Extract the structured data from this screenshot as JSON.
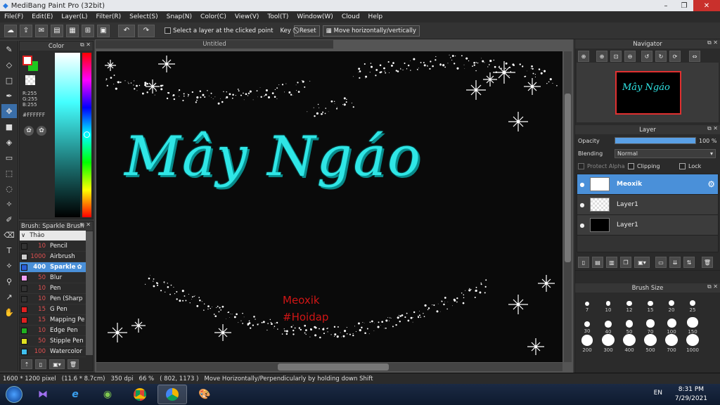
{
  "window": {
    "title": "MediBang Paint Pro (32bit)",
    "minimize": "–",
    "restore": "❐",
    "close": "✕"
  },
  "menu": [
    "File(F)",
    "Edit(E)",
    "Layer(L)",
    "Filter(R)",
    "Select(S)",
    "Snap(N)",
    "Color(C)",
    "View(V)",
    "Tool(T)",
    "Window(W)",
    "Cloud",
    "Help"
  ],
  "toolbar": {
    "select_layer_label": "Select a layer at the clicked point",
    "key_label": "Key",
    "reset_label": "Reset",
    "move_hv_label": "Move horizontally/vertically"
  },
  "color_panel": {
    "title": "Color",
    "r": "R:255",
    "g": "G:255",
    "b": "B:255",
    "hex": "#FFFFFF",
    "fg": "#ffffff",
    "bg": "#1ec81e"
  },
  "brush_panel": {
    "title": "Brush: Sparkle Brush",
    "group": "Thảo",
    "items": [
      {
        "size": "10",
        "name": "Pencil",
        "color": "#333333"
      },
      {
        "size": "1000",
        "name": "Airbrush",
        "color": "#cccccc"
      },
      {
        "size": "400",
        "name": "Sparkle",
        "color": "#2a5fd9",
        "selected": true
      },
      {
        "size": "50",
        "name": "Blur",
        "color": "#f2a0f2"
      },
      {
        "size": "10",
        "name": "Pen",
        "color": "#333333"
      },
      {
        "size": "10",
        "name": "Pen (Sharp",
        "color": "#333333"
      },
      {
        "size": "15",
        "name": "G Pen",
        "color": "#e02020"
      },
      {
        "size": "15",
        "name": "Mapping Pe",
        "color": "#e02020"
      },
      {
        "size": "10",
        "name": "Edge Pen",
        "color": "#20b020"
      },
      {
        "size": "50",
        "name": "Stipple Pen",
        "color": "#e0e020"
      },
      {
        "size": "100",
        "name": "Watercolor",
        "color": "#40c0f0"
      }
    ]
  },
  "canvas": {
    "tab": "Untitled",
    "title_text": "Mây Ngáo",
    "credit1": "Meoxik",
    "credit2": "#Hoidap"
  },
  "navigator": {
    "title": "Navigator",
    "thumb_text": "Mây Ngáo"
  },
  "layer_panel": {
    "title": "Layer",
    "opacity_label": "Opacity",
    "opacity_value": "100 %",
    "opacity": 1.0,
    "blending_label": "Blending",
    "blending_value": "Normal",
    "protect_alpha": "Protect Alpha",
    "clipping": "Clipping",
    "lock": "Lock",
    "layers": [
      {
        "name": "Meoxik",
        "selected": true
      },
      {
        "name": "Layer1",
        "selected": false
      },
      {
        "name": "Layer1",
        "selected": false
      }
    ]
  },
  "brush_size": {
    "title": "Brush Size",
    "sizes": [
      "7",
      "10",
      "12",
      "15",
      "20",
      "25",
      "30",
      "40",
      "50",
      "70",
      "100",
      "150",
      "200",
      "300",
      "400",
      "500",
      "700",
      "1000"
    ]
  },
  "status": {
    "size": "1600 * 1200 pixel",
    "cm": "(11.6 * 8.7cm)",
    "dpi": "350 dpi",
    "zoom": "66 %",
    "coords": "( 802, 1173 )",
    "hint": "Move Horizontally/Perpendicularly by holding down Shift"
  },
  "taskbar": {
    "lang": "EN",
    "time": "8:31 PM",
    "date": "7/29/2021"
  }
}
